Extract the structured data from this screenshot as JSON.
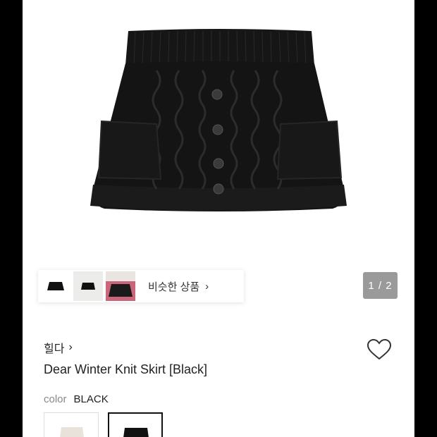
{
  "product": {
    "brand": "힐다",
    "title": "Dear Winter Knit Skirt [Black]",
    "color_label": "color",
    "color_value": "BLACK"
  },
  "gallery": {
    "pager": "1 / 2"
  },
  "similar": {
    "label": "비슷한 상품",
    "chevron": "›"
  },
  "icons": {
    "brand_chevron": "›",
    "heart": "heart-icon"
  },
  "colors": {
    "skirt": "#141414",
    "pager_bg": "#9a9a9a",
    "selected_border": "#111111"
  }
}
